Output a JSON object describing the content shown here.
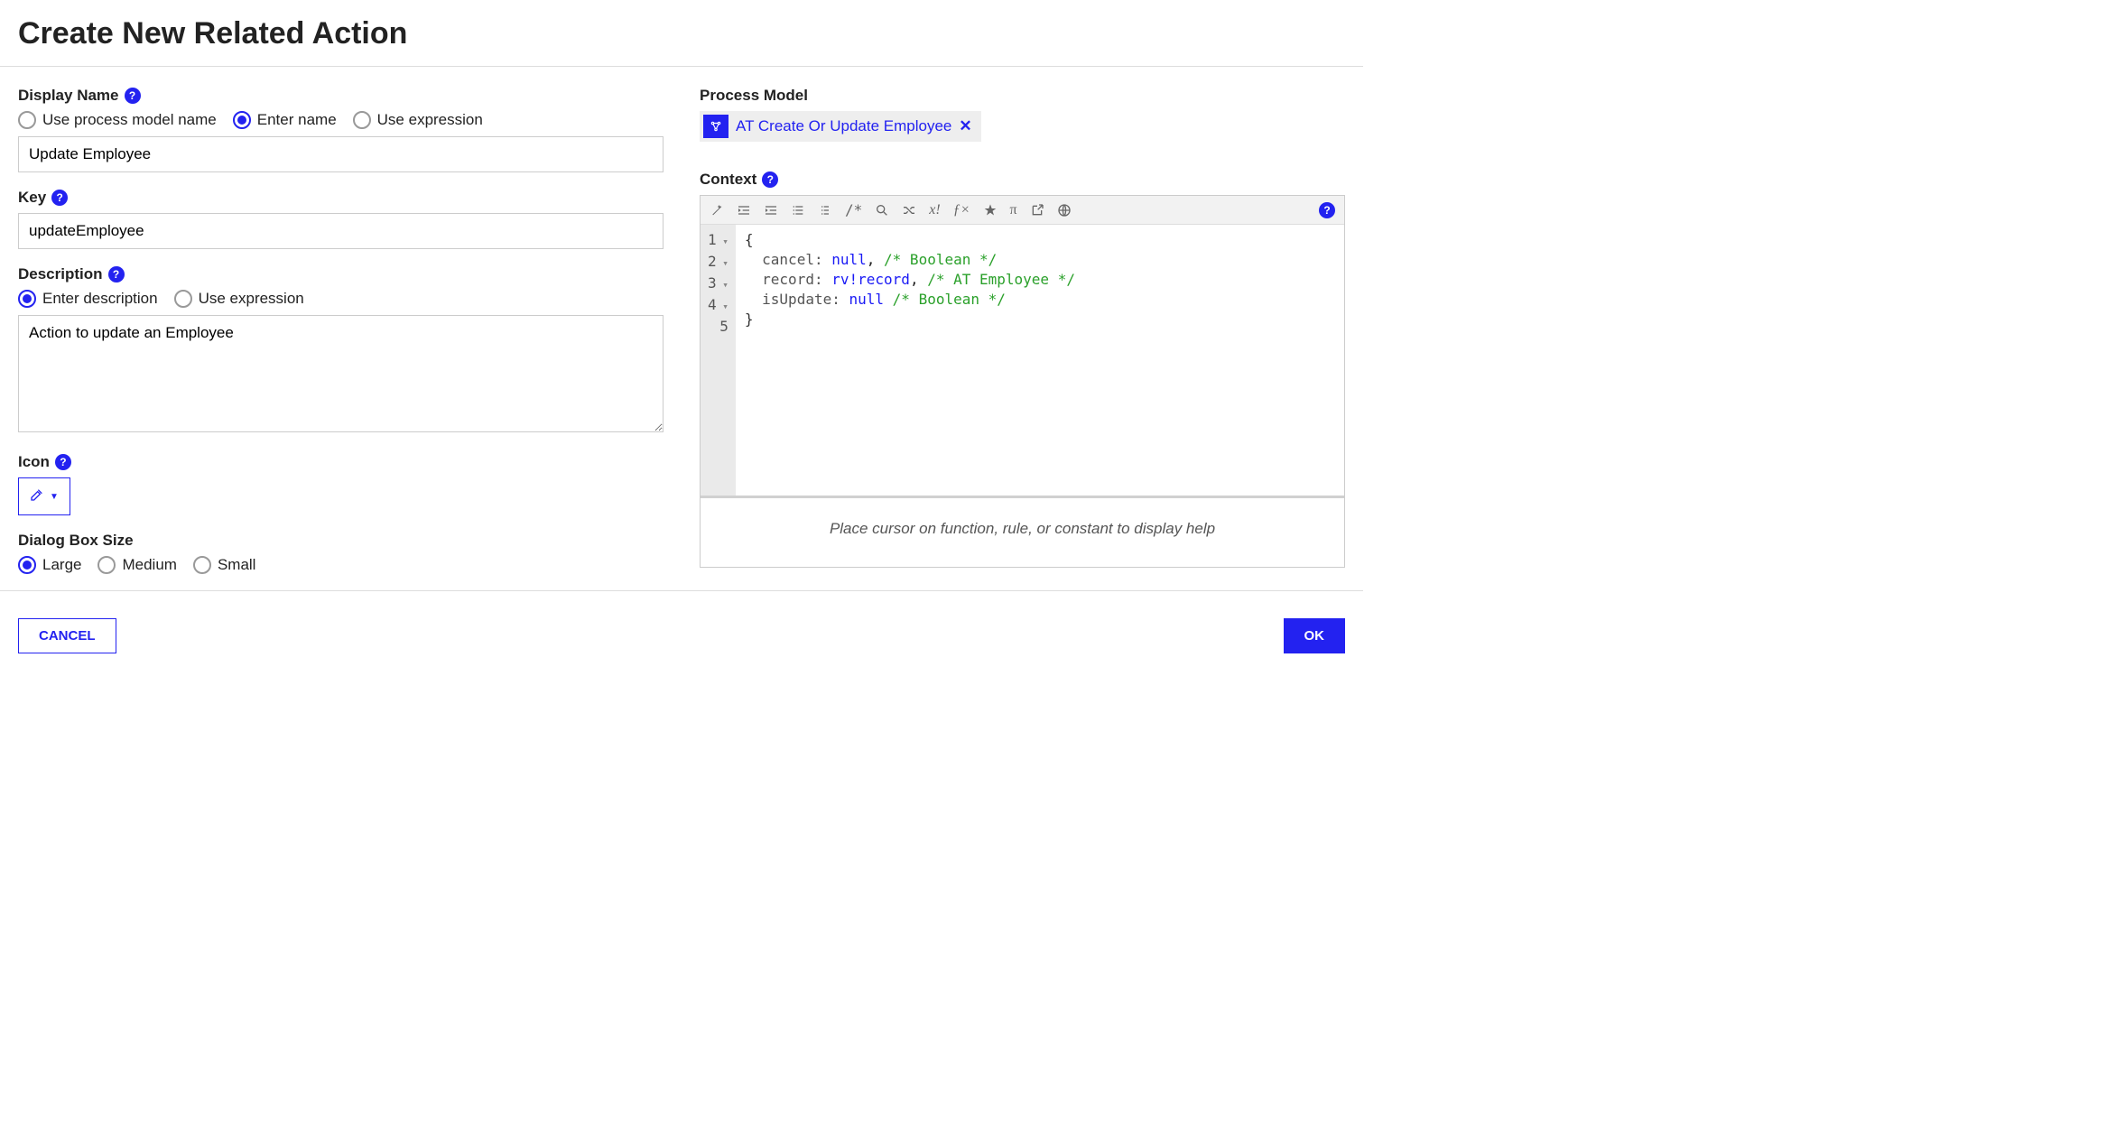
{
  "title": "Create New Related Action",
  "left": {
    "displayName": {
      "label": "Display Name",
      "options": {
        "useModel": "Use process model name",
        "enterName": "Enter name",
        "useExpr": "Use expression"
      },
      "selected": "enterName",
      "value": "Update Employee"
    },
    "key": {
      "label": "Key",
      "value": "updateEmployee"
    },
    "description": {
      "label": "Description",
      "options": {
        "enter": "Enter description",
        "useExpr": "Use expression"
      },
      "selected": "enter",
      "value": "Action to update an Employee"
    },
    "icon": {
      "label": "Icon"
    },
    "dialogSize": {
      "label": "Dialog Box Size",
      "options": {
        "large": "Large",
        "medium": "Medium",
        "small": "Small"
      },
      "selected": "large"
    }
  },
  "right": {
    "processModel": {
      "label": "Process Model",
      "chip": "AT Create Or Update Employee"
    },
    "context": {
      "label": "Context",
      "lines": {
        "1": "{",
        "2_key": "cancel:",
        "2_val": "null",
        "2_cmt": "/* Boolean */",
        "3_key": "record:",
        "3_val": "rv!record",
        "3_cmt": "/* AT Employee */",
        "4_key": "isUpdate:",
        "4_val": "null",
        "4_cmt": "/* Boolean */",
        "5": "}"
      },
      "gutter": {
        "1": "1",
        "2": "2",
        "3": "3",
        "4": "4",
        "5": "5"
      },
      "helpText": "Place cursor on function, rule, or constant to display help"
    }
  },
  "footer": {
    "cancel": "CANCEL",
    "ok": "OK"
  }
}
